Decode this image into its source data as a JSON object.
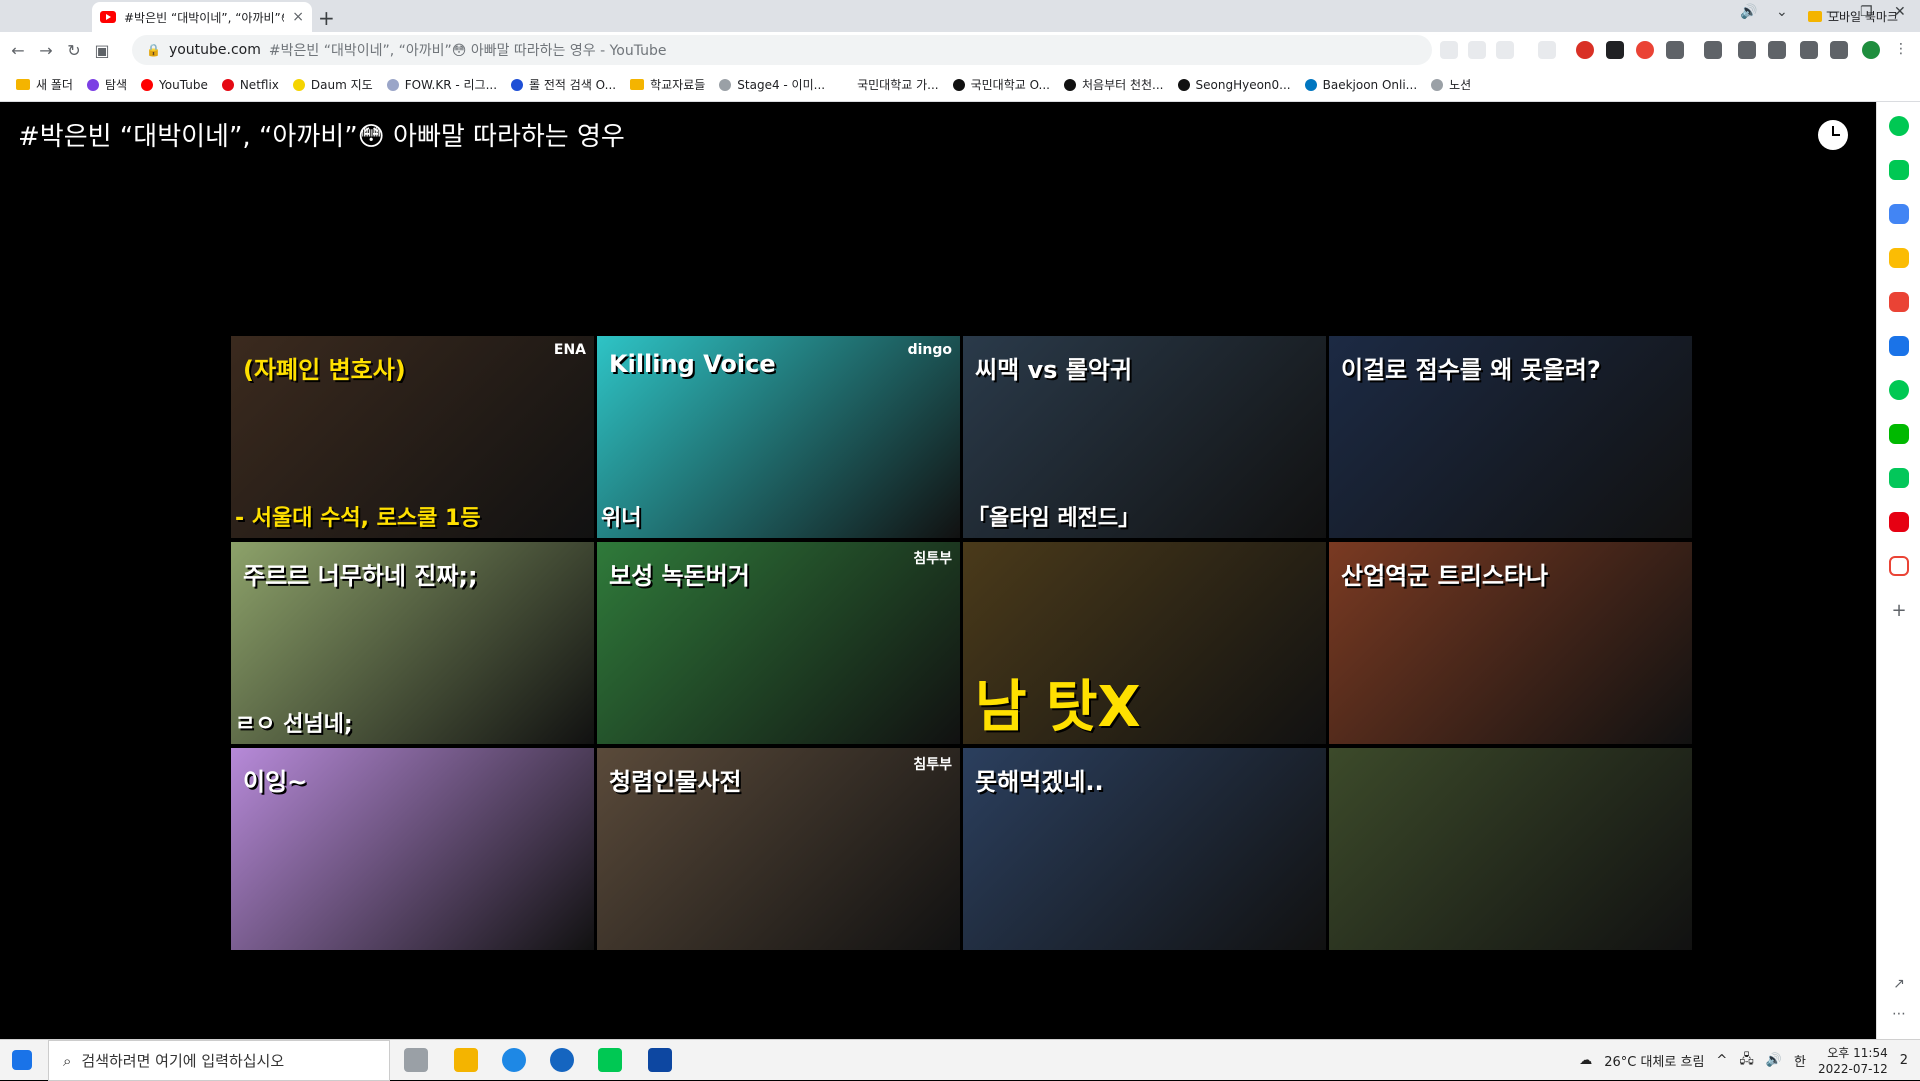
{
  "browser": {
    "tab_title": "#박은빈 “대박이네”, “아까비”😳",
    "url_domain": "youtube.com",
    "url_rest": "#박은빈 “대박이네”, “아까비”😳 아빠말 따라하는 영우 - YouTube",
    "new_tab": "+",
    "tab_close": "×"
  },
  "bookmarks": [
    {
      "label": "새 폴더",
      "icon": "folder-icon",
      "color": "#f4b400"
    },
    {
      "label": "탐색",
      "icon": "circle-icon",
      "color": "#7b3fe4"
    },
    {
      "label": "YouTube",
      "icon": "youtube-icon",
      "color": "#ff0000"
    },
    {
      "label": "Netflix",
      "icon": "netflix-icon",
      "color": "#e50914"
    },
    {
      "label": "Daum 지도",
      "icon": "daum-icon",
      "color": "#f5d400"
    },
    {
      "label": "FOW.KR - 리그...",
      "icon": "fow-icon",
      "color": "#9aa5c8"
    },
    {
      "label": "롤 전적 검색 O...",
      "icon": "opgg-icon",
      "color": "#1e4fd6"
    },
    {
      "label": "학교자료들",
      "icon": "folder-icon",
      "color": "#f4b400"
    },
    {
      "label": "Stage4 - 이미...",
      "icon": "stage-icon",
      "color": "#9aa0a6"
    },
    {
      "label": "국민대학교 가...",
      "icon": "kookmin-icon",
      "color": "#ffffff"
    },
    {
      "label": "국민대학교 O...",
      "icon": "kookmin-icon",
      "color": "#111111"
    },
    {
      "label": "처음부터 천천...",
      "icon": "notion-icon",
      "color": "#111111"
    },
    {
      "label": "SeongHyeon0...",
      "icon": "github-icon",
      "color": "#111111"
    },
    {
      "label": "Baekjoon Onli...",
      "icon": "baekjoon-icon",
      "color": "#0076c0"
    },
    {
      "label": "노션",
      "icon": "notion-icon",
      "color": "#9aa0a6"
    }
  ],
  "bookmarks_right": "모바일 북마크",
  "player": {
    "title": "#박은빈 “대박이네”, “아까비”😳 아빠말 따라하는 영우"
  },
  "thumbnails": [
    {
      "caption": "(자폐인 변호사)",
      "caption2": "- 서울대 수석, 로스쿨 1등",
      "badge": "ENA",
      "bg": "#3b2a1e"
    },
    {
      "caption": "Killing Voice",
      "caption2": "위너",
      "badge": "dingo",
      "bg": "#2ec4c6"
    },
    {
      "caption": "씨맥 vs 롤악귀",
      "caption2": "「올타임 레전드」",
      "badge": "",
      "bg": "#2a3a4a"
    },
    {
      "caption": "이걸로 점수를 왜 못올려?",
      "caption2": "",
      "badge": "",
      "bg": "#1c2a44"
    },
    {
      "caption": "주르르 너무하네 진짜;;",
      "caption2": "ㄹㅇ 선넘네;",
      "badge": "",
      "bg": "#8da26a"
    },
    {
      "caption": "보성 녹돈버거",
      "caption2": "",
      "badge": "침투부",
      "bg": "#2f7a3a"
    },
    {
      "caption": "남 탓X",
      "caption2": "",
      "badge": "",
      "bg": "#4a3a1a"
    },
    {
      "caption": "산업역군 트리스타나",
      "caption2": "",
      "badge": "",
      "bg": "#7a3a22"
    },
    {
      "caption": "이잉~",
      "caption2": "",
      "badge": "",
      "bg": "#b78ad9"
    },
    {
      "caption": "청렴인물사전",
      "caption2": "",
      "badge": "침투부",
      "bg": "#5a4a3a"
    },
    {
      "caption": "못해먹겠네..",
      "caption2": "",
      "badge": "",
      "bg": "#2b3f5e"
    },
    {
      "caption": "",
      "caption2": "",
      "badge": "",
      "bg": "#3c4a2a"
    }
  ],
  "taskbar": {
    "search_placeholder": "검색하려면 여기에 입력하십시오",
    "weather": "26°C  대체로 흐림",
    "ime": "한",
    "time": "오후 11:54",
    "date": "2022-07-12",
    "notifications": "2"
  }
}
